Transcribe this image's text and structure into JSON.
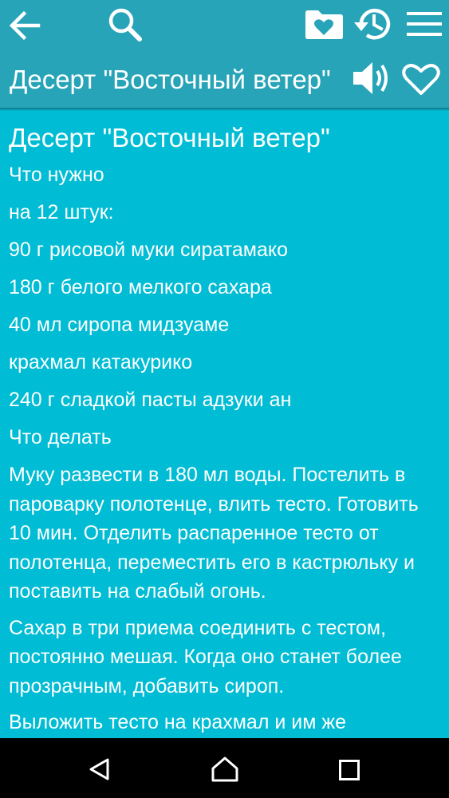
{
  "app_bar": {
    "title": "Десерт \"Восточный ветер\""
  },
  "icons": {
    "back": "arrow-left-icon",
    "search": "search-icon",
    "favorites_folder": "folder-heart-icon",
    "history": "history-icon",
    "menu": "hamburger-menu-icon",
    "speak": "speaker-icon",
    "favorite": "heart-outline-icon"
  },
  "colors": {
    "app_bar": "#27a4b8",
    "content_bg": "#00bcd4",
    "text": "#ffffff",
    "nav_bar": "#000000"
  },
  "recipe": {
    "title": "Десерт \"Восточный ветер\"",
    "lines": [
      "Что нужно",
      "на 12 штук:",
      "90 г рисовой муки сиратамако",
      "180 г белого мелкого сахара",
      "40 мл сиропа мидзуаме",
      "крахмал катакурико",
      "240 г сладкой пасты адзуки ан",
      "Что делать"
    ],
    "paragraphs": [
      "Муку развести в 180 мл воды. Постелить в пароварку полотенце, влить тесто. Готовить 10 мин. Отделить распаренное тесто от полотенца, переместить его в кастрюльку и поставить на слабый огонь.",
      "Сахар в три приема соединить с тестом, постоянно мешая. Когда оно станет более прозрачным, добавить сироп.",
      "Выложить тесто на крахмал и им же"
    ]
  },
  "system_nav": {
    "back": "nav-back-triangle-icon",
    "home": "nav-home-icon",
    "recents": "nav-recents-square-icon"
  }
}
